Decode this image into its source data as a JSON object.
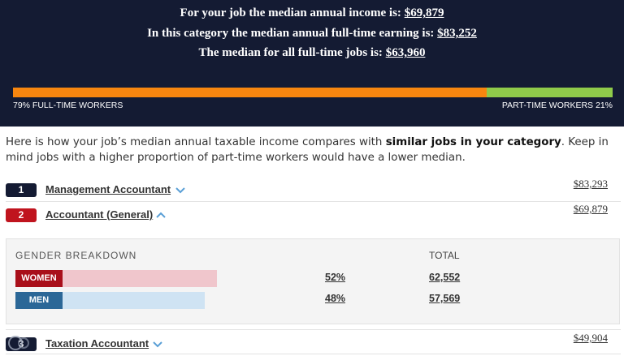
{
  "headlines": [
    {
      "prefix": "For your job the median annual income is: ",
      "value": "$69,879"
    },
    {
      "prefix": "In this category the median annual full-time earning is: ",
      "value": "$83,252"
    },
    {
      "prefix": "The median for all full-time jobs is: ",
      "value": "$63,960"
    }
  ],
  "workers": {
    "full_time_label": "79% FULL-TIME WORKERS",
    "part_time_label": "PART-TIME WORKERS 21%",
    "full_time_fraction": 0.79,
    "colors": {
      "full_time": "#f7860f",
      "part_time": "#8fcb4a"
    }
  },
  "intro": {
    "text1": "Here is how your job’s median annual taxable income compares with ",
    "bold": "similar jobs in your category",
    "text2": ". Keep in mind jobs with a higher proportion of part-time workers would have a lower median."
  },
  "jobs": [
    {
      "rank": "1",
      "name": "Management Accountant",
      "amount": "$83,293",
      "expanded": false,
      "color": "#141b33"
    },
    {
      "rank": "2",
      "name": "Accountant (General)",
      "amount": "$69,879",
      "expanded": true,
      "color": "#c0141e"
    },
    {
      "rank": "3",
      "name": "Taxation Accountant",
      "amount": "$49,904",
      "expanded": false,
      "color": "#141b33"
    }
  ],
  "gender": {
    "heading": "GENDER BREAKDOWN",
    "total_heading": "TOTAL",
    "women": {
      "label": "WOMEN",
      "pct": "52%",
      "total": "62,552",
      "fraction": 0.52,
      "color": "#a90f1a",
      "track_color": "#f0c6cc"
    },
    "men": {
      "label": "MEN",
      "pct": "48%",
      "total": "57,569",
      "fraction": 0.48,
      "color": "#2b6797",
      "track_color": "#cfe3f3"
    }
  },
  "icons": {
    "chevron": "chevron-icon",
    "watermark": "watermark-logo"
  }
}
